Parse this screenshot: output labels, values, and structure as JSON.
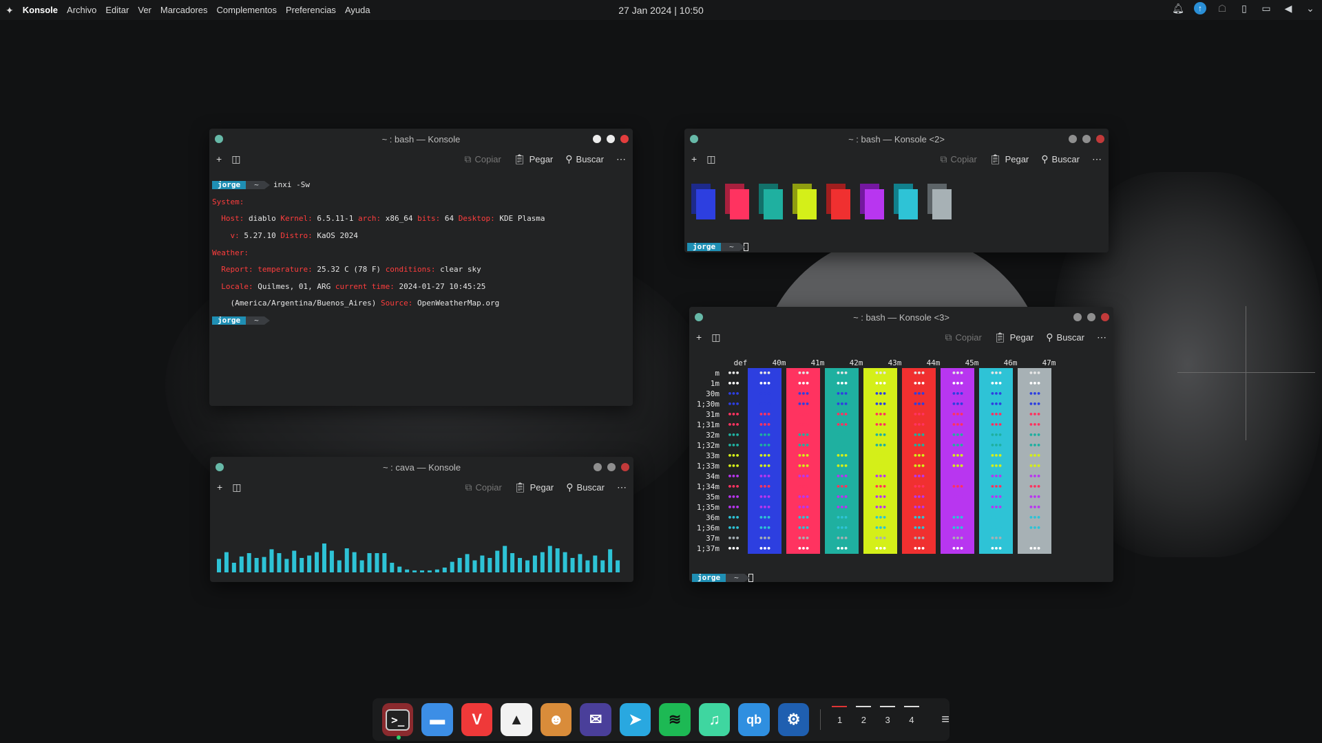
{
  "topbar": {
    "app_name": "Konsole",
    "menus": [
      "Archivo",
      "Editar",
      "Ver",
      "Marcadores",
      "Complementos",
      "Preferencias",
      "Ayuda"
    ],
    "clock": "27 Jan 2024 | 10:50",
    "tray_icons": [
      "bell-icon",
      "update-icon",
      "ghost-icon",
      "clipboard-icon",
      "display-icon",
      "volume-icon",
      "chevron-down-icon"
    ]
  },
  "toolbar": {
    "copy": "Copiar",
    "paste": "Pegar",
    "find": "Buscar"
  },
  "windows": {
    "w1": {
      "title": "~ : bash — Konsole",
      "prompt_user": "jorge",
      "prompt_dir": "~",
      "command": "inxi -Sw",
      "system_label": "System:",
      "host_label": "Host:",
      "host": "diablo",
      "kernel_label": "Kernel:",
      "kernel": "6.5.11-1",
      "arch_label": "arch:",
      "arch": "x86_64",
      "bits_label": "bits:",
      "bits": "64",
      "desktop_label": "Desktop:",
      "desktop": "KDE Plasma",
      "v_label": "v:",
      "v": "5.27.10",
      "distro_label": "Distro:",
      "distro": "KaOS 2024",
      "weather_label": "Weather:",
      "report_label": "Report:",
      "temp_label": "temperature:",
      "temp": "25.32 C (78 F)",
      "cond_label": "conditions:",
      "cond": "clear sky",
      "locale_label": "Locale:",
      "locale": "Quilmes, 01, ARG",
      "time_label": "current time:",
      "time": "2024-01-27 10:45:25",
      "tz": "(America/Argentina/Buenos_Aires)",
      "source_label": "Source:",
      "source": "OpenWeatherMap.org"
    },
    "w2": {
      "title": "~ : bash — Konsole <2>",
      "prompt_user": "jorge",
      "prompt_dir": "~",
      "swatches": [
        {
          "back": "#1d2a8a",
          "front": "#2d3fe0"
        },
        {
          "back": "#a8203e",
          "front": "#ff3360"
        },
        {
          "back": "#12716a",
          "front": "#1fb0a0"
        },
        {
          "back": "#8f9d10",
          "front": "#d4ef19"
        },
        {
          "back": "#a01e1e",
          "front": "#f03030"
        },
        {
          "back": "#7418a0",
          "front": "#b836f0"
        },
        {
          "back": "#11808c",
          "front": "#2ec3d6"
        },
        {
          "back": "#5d6468",
          "front": "#a7b1b5"
        }
      ]
    },
    "w3": {
      "title": "~ : bash — Konsole <3>",
      "prompt_user": "jorge",
      "prompt_dir": "~",
      "col_headers": [
        "def",
        "40m",
        "41m",
        "42m",
        "43m",
        "44m",
        "45m",
        "46m",
        "47m"
      ],
      "row_labels": [
        "m",
        "1m",
        "30m",
        "1;30m",
        "31m",
        "1;31m",
        "32m",
        "1;32m",
        "33m",
        "1;33m",
        "34m",
        "1;34m",
        "35m",
        "1;35m",
        "36m",
        "1;36m",
        "37m",
        "1;37m"
      ],
      "cell_text": "•••",
      "bg_colors": [
        "transparent",
        "#2d3fe0",
        "#ff3360",
        "#1fb0a0",
        "#d4ef19",
        "#f03030",
        "#b836f0",
        "#2ec3d6",
        "#a7b1b5"
      ],
      "fg_colors": [
        "#e6e6e6",
        "#ffffff",
        "#2d3fe0",
        "#2d3fe0",
        "#ff3360",
        "#ff3360",
        "#1fb0a0",
        "#1fb0a0",
        "#d4ef19",
        "#d4ef19",
        "#b836f0",
        "#ff3360",
        "#b836f0",
        "#b836f0",
        "#2ec3d6",
        "#2ec3d6",
        "#a7b1b5",
        "#ffffff"
      ]
    },
    "w4": {
      "title": "~ : cava — Konsole",
      "bar_color": "#2ec3d6",
      "bars": [
        0.28,
        0.42,
        0.2,
        0.33,
        0.4,
        0.3,
        0.32,
        0.48,
        0.4,
        0.28,
        0.45,
        0.3,
        0.35,
        0.42,
        0.6,
        0.45,
        0.25,
        0.5,
        0.42,
        0.25,
        0.4,
        0.4,
        0.4,
        0.2,
        0.12,
        0.06,
        0.04,
        0.04,
        0.04,
        0.06,
        0.1,
        0.22,
        0.3,
        0.38,
        0.25,
        0.35,
        0.3,
        0.45,
        0.55,
        0.4,
        0.3,
        0.25,
        0.35,
        0.42,
        0.55,
        0.5,
        0.42,
        0.3,
        0.38,
        0.25,
        0.35,
        0.25,
        0.48,
        0.25
      ]
    }
  },
  "dock": {
    "apps": [
      "terminal-icon",
      "files-icon",
      "vivaldi-icon",
      "inkscape-icon",
      "gimp-icon",
      "mailspring-icon",
      "telegram-icon",
      "spotify-icon",
      "music-icon",
      "qbittorrent-icon",
      "steam-icon"
    ],
    "desktops": [
      "1",
      "2",
      "3",
      "4"
    ],
    "overflow": "≡"
  }
}
